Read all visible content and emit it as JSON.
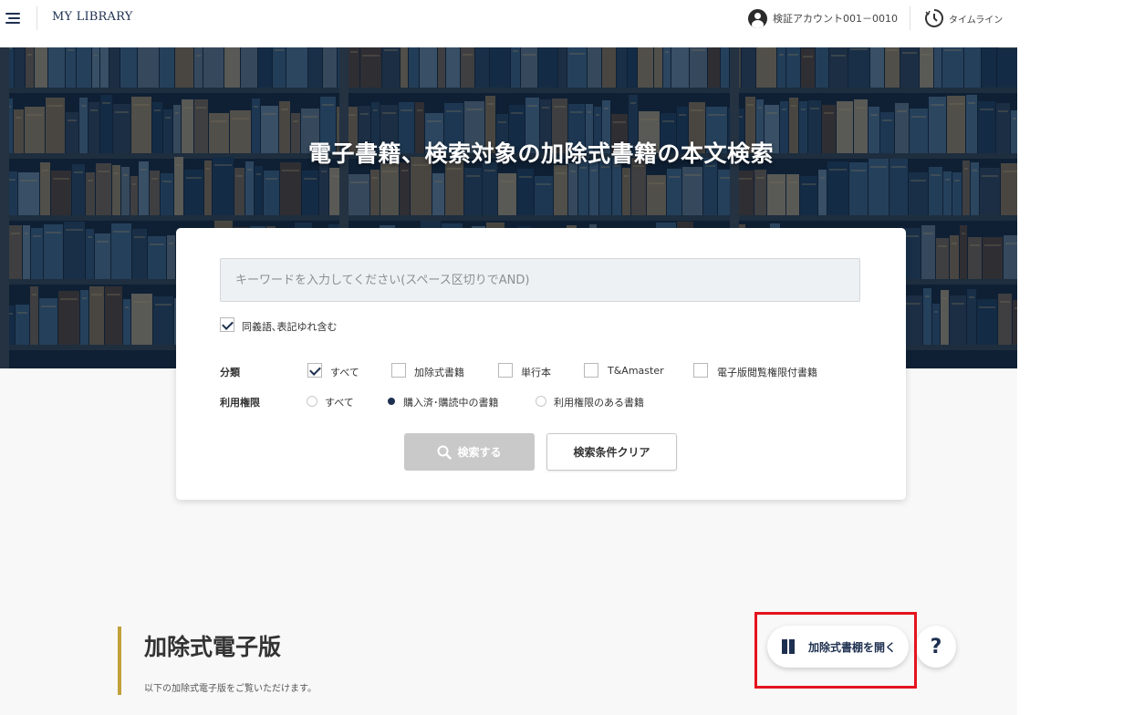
{
  "header": {
    "logo": "MY LIBRARY",
    "account_label": "検証アカウント001－0010",
    "timeline_label": "タイムライン"
  },
  "hero": {
    "title": "電子書籍、検索対象の加除式書籍の本文検索"
  },
  "search": {
    "keyword_placeholder": "キーワードを入力してください(スペース区切りでAND)",
    "keyword_value": "",
    "synonym_label": "同義語､表記ゆれ含む",
    "synonym_checked": true,
    "category": {
      "label": "分類",
      "options": [
        {
          "label": "すべて",
          "checked": true
        },
        {
          "label": "加除式書籍",
          "checked": false
        },
        {
          "label": "単行本",
          "checked": false
        },
        {
          "label": "T&Amaster",
          "checked": false
        },
        {
          "label": "電子版閲覧権限付書籍",
          "checked": false
        }
      ]
    },
    "permission": {
      "label": "利用権限",
      "options": [
        {
          "label": "すべて",
          "selected": false
        },
        {
          "label": "購入済･購読中の書籍",
          "selected": true
        },
        {
          "label": "利用権限のある書籍",
          "selected": false
        }
      ]
    },
    "search_button": "検索する",
    "clear_button": "検索条件クリア"
  },
  "section": {
    "title": "加除式電子版",
    "description": "以下の加除式電子版をご覧いただけます。",
    "open_shelf_button": "加除式書棚を開く",
    "help_button": "?"
  },
  "colors": {
    "navy": "#1e3050",
    "accent_bar": "#c2a13a",
    "highlight": "#e4141e",
    "search_button_bg": "#c9c9c9"
  },
  "icons": {
    "menu": "hamburger-menu-icon",
    "account": "user-circle-icon",
    "timeline": "clock-icon",
    "search": "search-icon",
    "book": "book-icon"
  }
}
